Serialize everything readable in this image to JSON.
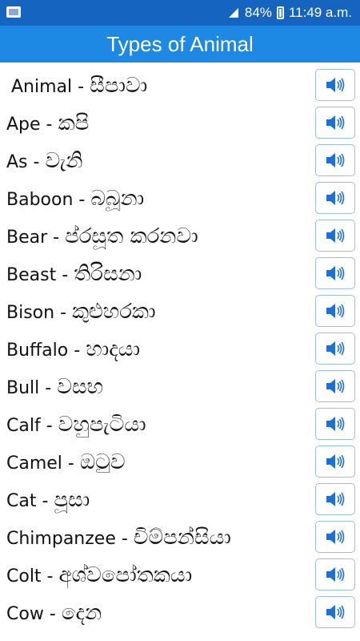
{
  "status": {
    "battery": "84%",
    "time": "11:49 a.m."
  },
  "title": "Types of Animal",
  "items": [
    {
      "en": "Animal",
      "si": "සීපාවා"
    },
    {
      "en": "Ape",
      "si": "කපි"
    },
    {
      "en": "As",
      "si": "වැනි"
    },
    {
      "en": "Baboon",
      "si": "බබූනා"
    },
    {
      "en": "Bear",
      "si": "ප්රසූත කරනවා"
    },
    {
      "en": "Beast",
      "si": "තිරිසනා"
    },
    {
      "en": "Bison",
      "si": "කුළුහරකා"
    },
    {
      "en": "Buffalo",
      "si": "හාදයා"
    },
    {
      "en": "Bull",
      "si": "වසභ"
    },
    {
      "en": "Calf",
      "si": "වහුපැටියා"
    },
    {
      "en": "Camel",
      "si": "ඔටුව"
    },
    {
      "en": "Cat",
      "si": "පූසා"
    },
    {
      "en": "Chimpanzee",
      "si": "චිම්පන්සියා"
    },
    {
      "en": "Colt",
      "si": "අශ්වපෝතකයා"
    },
    {
      "en": "Cow",
      "si": "දෙන"
    }
  ],
  "icons": {
    "speak_button": "speaker-icon"
  },
  "colors": {
    "status_bar": "#1565c0",
    "app_bar": "#1e88e5",
    "speaker": "#1e6fd6"
  }
}
